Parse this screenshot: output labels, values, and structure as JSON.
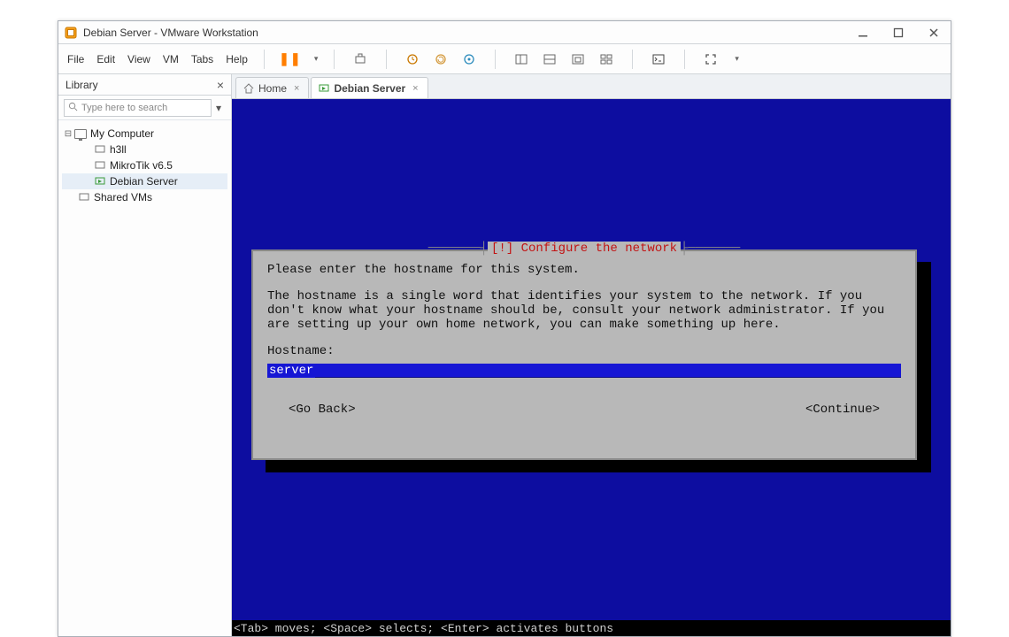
{
  "window": {
    "title": "Debian Server - VMware Workstation"
  },
  "menubar": {
    "items": [
      "File",
      "Edit",
      "View",
      "VM",
      "Tabs",
      "Help"
    ]
  },
  "library": {
    "title": "Library",
    "search_placeholder": "Type here to search",
    "tree": {
      "root": {
        "label": "My Computer",
        "expanded": true
      },
      "items": [
        {
          "label": "h3ll"
        },
        {
          "label": "MikroTik v6.5"
        },
        {
          "label": "Debian Server",
          "selected": true
        }
      ],
      "shared": {
        "label": "Shared VMs"
      }
    }
  },
  "tabs": [
    {
      "label": "Home",
      "active": false,
      "icon": "home"
    },
    {
      "label": "Debian Server",
      "active": true,
      "icon": "vm"
    }
  ],
  "installer": {
    "title_prefix": "[!]",
    "title": "Configure the network",
    "prompt": "Please enter the hostname for this system.",
    "help": "The hostname is a single word that identifies your system to the network. If you don't know what your hostname should be, consult your network administrator. If you are setting up your own home network, you can make something up here.",
    "field_label": "Hostname:",
    "field_value": "server",
    "btn_back": "<Go Back>",
    "btn_continue": "<Continue>",
    "footer": "<Tab> moves; <Space> selects; <Enter> activates buttons"
  },
  "colors": {
    "installer_bg": "#0d0da0",
    "dialog_bg": "#b8b8b8",
    "highlight": "#1616d4",
    "title_red": "#c21313"
  }
}
